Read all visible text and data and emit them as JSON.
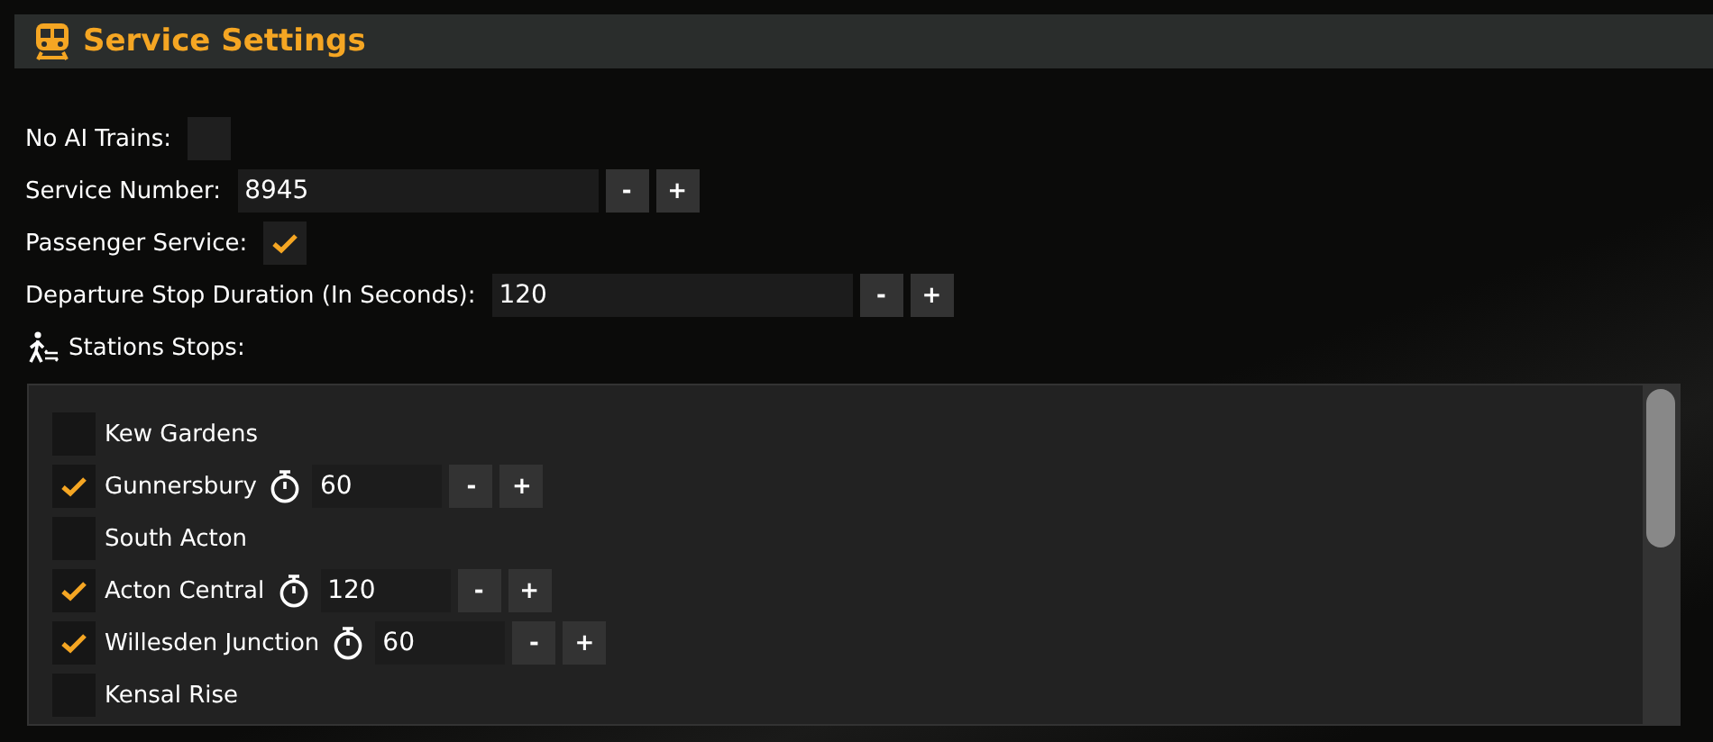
{
  "title": "Service Settings",
  "no_ai_trains": {
    "label": "No AI Trains:",
    "checked": false
  },
  "service_number": {
    "label": "Service Number:",
    "value": "8945",
    "minus": "-",
    "plus": "+"
  },
  "passenger_service": {
    "label": "Passenger Service:",
    "checked": true
  },
  "departure_stop_duration": {
    "label": "Departure Stop Duration (In Seconds):",
    "value": "120",
    "minus": "-",
    "plus": "+"
  },
  "stations_heading": "Stations Stops:",
  "stations": [
    {
      "name": "Kew Gardens",
      "checked": false
    },
    {
      "name": "Gunnersbury",
      "checked": true,
      "duration": "60",
      "minus": "-",
      "plus": "+"
    },
    {
      "name": "South Acton",
      "checked": false
    },
    {
      "name": "Acton Central",
      "checked": true,
      "duration": "120",
      "minus": "-",
      "plus": "+"
    },
    {
      "name": "Willesden Junction",
      "checked": true,
      "duration": "60",
      "minus": "-",
      "plus": "+"
    },
    {
      "name": "Kensal Rise",
      "checked": false
    }
  ]
}
